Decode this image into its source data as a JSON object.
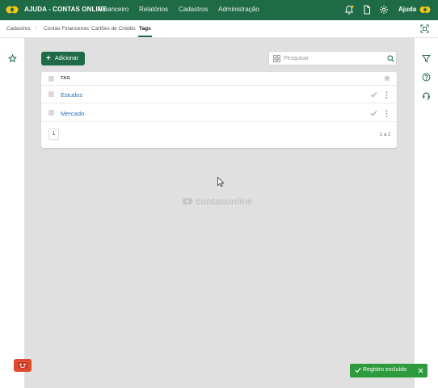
{
  "header": {
    "brand": "AJUDA - CONTAS ONLINE",
    "nav": [
      "Financeiro",
      "Relatórios",
      "Cadastros",
      "Administração"
    ],
    "user_name": "Ajuda",
    "icons": [
      "bell-icon",
      "document-icon",
      "gear-icon"
    ]
  },
  "breadcrumb": {
    "root": "Cadastros",
    "tabs": [
      "Contas Financeiras",
      "Cartões de Crédito",
      "Tags"
    ],
    "active": "Tags"
  },
  "toolbar": {
    "add_label": "Adicionar",
    "search_placeholder": "Pesquisar"
  },
  "table": {
    "column": "TAG",
    "rows": [
      "Estudos",
      "Mercado"
    ],
    "page": "1",
    "range": "1 a 2"
  },
  "watermark": "contasonline",
  "toast": {
    "message": "Registro excluído"
  },
  "colors": {
    "brand_green": "#1f6b47",
    "accent_yellow": "#f5c518",
    "link_blue": "#2a6fb0",
    "toast_green": "#2e9a3e",
    "bot_red": "#e04a2f"
  }
}
